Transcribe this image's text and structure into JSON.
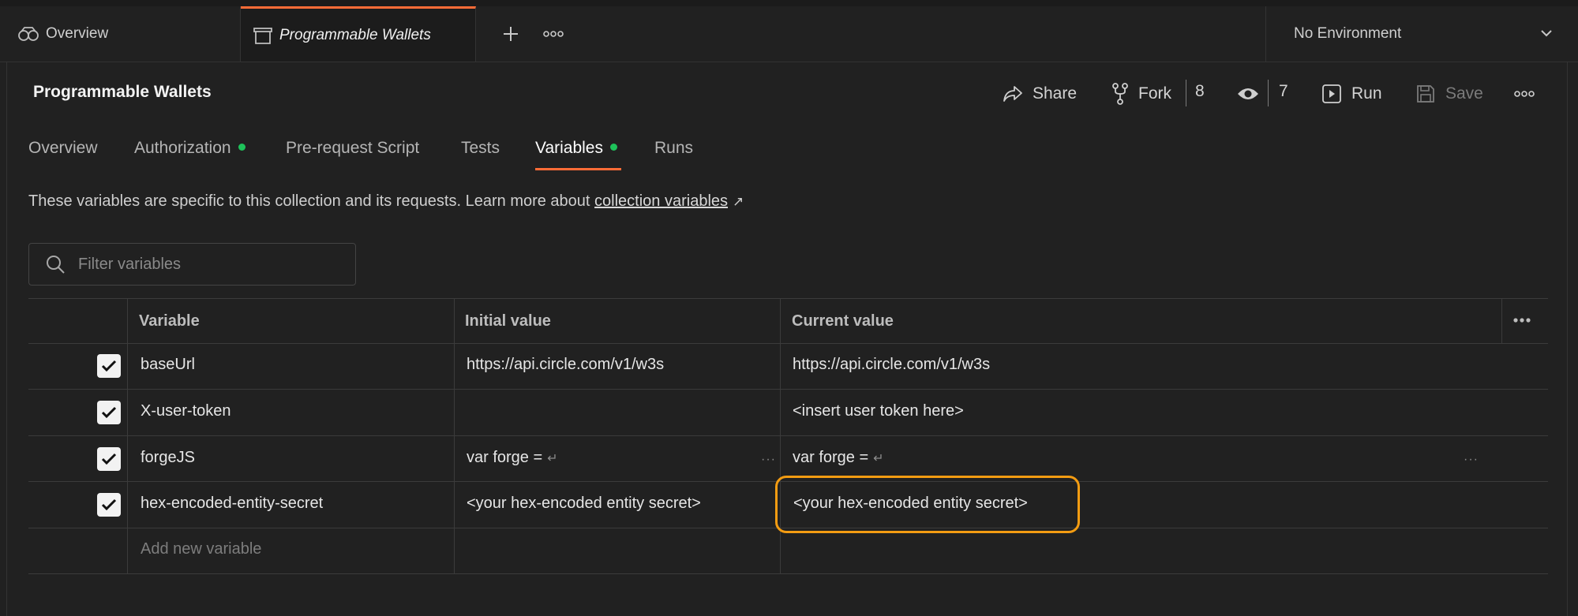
{
  "tabs": {
    "overview": {
      "label": "Overview",
      "icon": "overview-icon"
    },
    "collection": {
      "label": "Programmable Wallets",
      "icon": "collection-icon"
    },
    "new_tab_icon": "plus-icon",
    "more_icon": "more-icon"
  },
  "environment": {
    "label": "No Environment",
    "icon": "chevron-down-icon"
  },
  "header": {
    "title": "Programmable Wallets",
    "share": "Share",
    "fork": "Fork",
    "fork_count": "8",
    "watch_count": "7",
    "run": "Run",
    "save": "Save"
  },
  "subtabs": [
    {
      "label": "Overview"
    },
    {
      "label": "Authorization",
      "status_dot": true
    },
    {
      "label": "Pre-request Script"
    },
    {
      "label": "Tests"
    },
    {
      "label": "Variables",
      "status_dot": true,
      "active": true
    },
    {
      "label": "Runs"
    }
  ],
  "description": {
    "text": "These variables are specific to this collection and its requests. Learn more about",
    "link": "collection variables",
    "link_arrow": "↗"
  },
  "filter": {
    "placeholder": "Filter variables"
  },
  "table": {
    "columns": [
      "Variable",
      "Initial value",
      "Current value"
    ],
    "rows": [
      {
        "checked": true,
        "variable": "baseUrl",
        "initial": "https://api.circle.com/v1/w3s",
        "current": "https://api.circle.com/v1/w3s"
      },
      {
        "checked": true,
        "variable": "X-user-token",
        "initial": "",
        "current": "<insert user token here>"
      },
      {
        "checked": true,
        "variable": "forgeJS",
        "initial": "var forge =",
        "current": "var forge =",
        "multiline": true
      },
      {
        "checked": true,
        "variable": "hex-encoded-entity-secret",
        "initial": "<your hex-encoded entity secret>",
        "current": "<your hex-encoded entity secret>",
        "highlighted": true
      }
    ],
    "add_placeholder": "Add new variable"
  },
  "colors": {
    "accent": "#ff6c37",
    "status_dot": "#1ec25a",
    "highlight": "#f39c12",
    "background": "#212121"
  }
}
